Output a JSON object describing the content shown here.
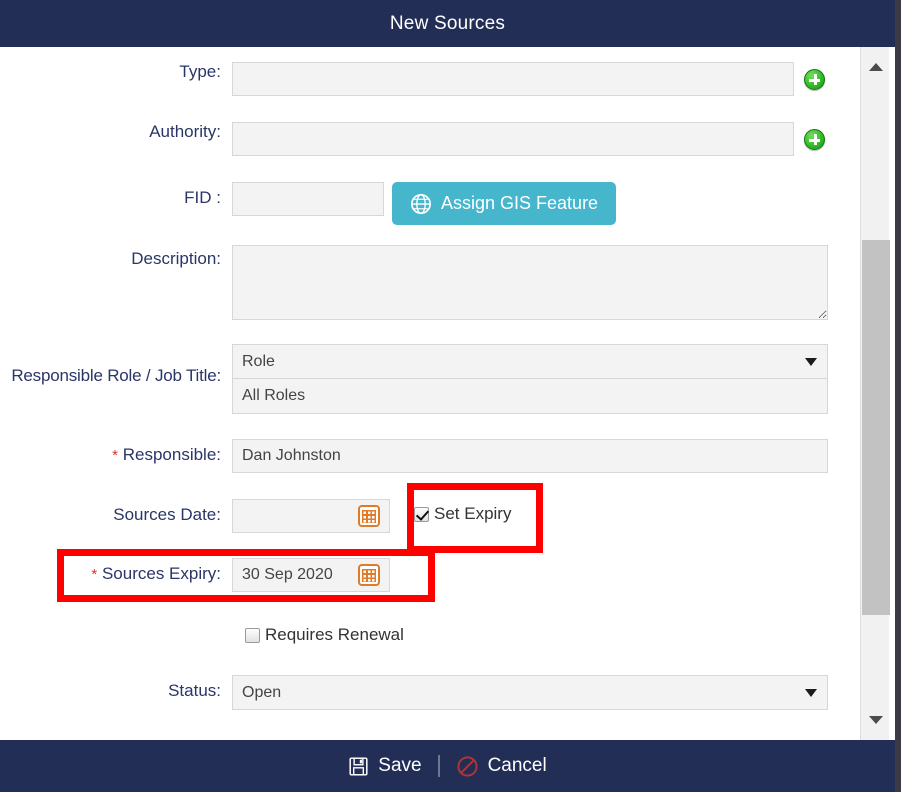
{
  "dialog": {
    "title": "New Sources"
  },
  "form": {
    "type": {
      "label": "Type:",
      "value": "",
      "add_icon": "plus-circle-icon"
    },
    "authority": {
      "label": "Authority:",
      "value": "",
      "add_icon": "plus-circle-icon"
    },
    "fid": {
      "label": "FID :",
      "value": "",
      "gis_button_label": "Assign GIS Feature",
      "gis_button_icon": "globe-icon",
      "gis_button_color": "#46b6cd"
    },
    "description": {
      "label": "Description:",
      "value": ""
    },
    "responsible_role": {
      "label": "Responsible Role / Job Title:",
      "role_value": "Role",
      "all_roles_value": "All Roles"
    },
    "responsible": {
      "label": "Responsible:",
      "required_marker": "*",
      "value": "Dan Johnston"
    },
    "sources_date": {
      "label": "Sources Date:",
      "value": "",
      "calendar_icon": "calendar-icon"
    },
    "set_expiry": {
      "label": "Set Expiry",
      "checked": true
    },
    "sources_expiry": {
      "label": "Sources Expiry:",
      "required_marker": "*",
      "value": "30 Sep 2020",
      "calendar_icon": "calendar-icon"
    },
    "requires_renewal": {
      "label": "Requires Renewal",
      "checked": false
    },
    "status": {
      "label": "Status:",
      "value": "Open"
    }
  },
  "footer": {
    "save_label": "Save",
    "save_icon": "floppy-disk-icon",
    "cancel_label": "Cancel",
    "cancel_icon": "no-entry-icon"
  },
  "colors": {
    "titlebar": "#232e56",
    "label_text": "#2a3568",
    "required_star": "#e03030",
    "highlight_box": "#fe0000",
    "accent_teal": "#46b6cd",
    "add_green": "#34bb28",
    "calendar_orange": "#e07b28"
  },
  "scrollbar": {
    "up_icon": "triangle-up-icon",
    "down_icon": "triangle-down-icon"
  }
}
